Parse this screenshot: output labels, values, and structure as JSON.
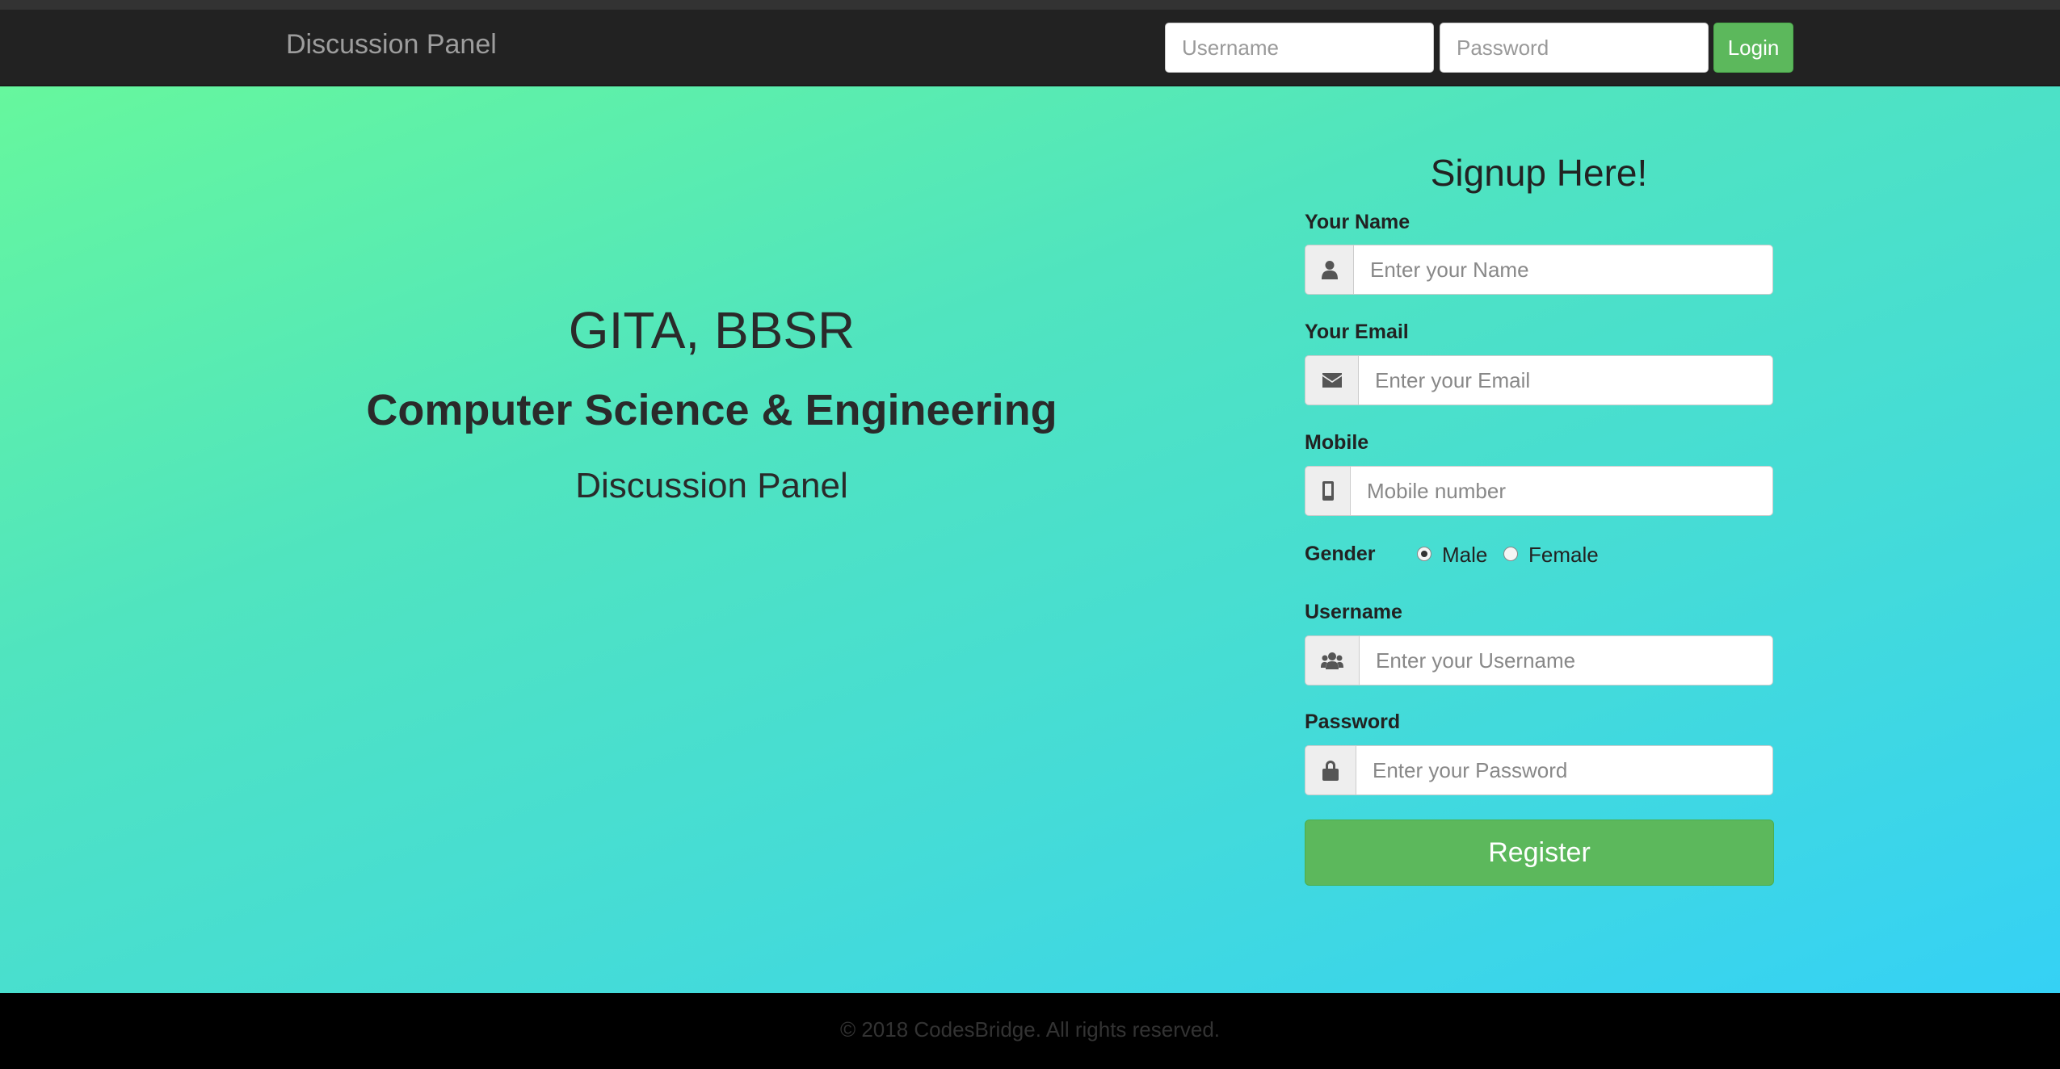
{
  "navbar": {
    "brand": "Discussion Panel",
    "username_placeholder": "Username",
    "password_placeholder": "Password",
    "login_label": "Login"
  },
  "hero": {
    "institute": "GITA, BBSR",
    "department": "Computer Science & Engineering",
    "subtitle": "Discussion Panel"
  },
  "signup": {
    "title": "Signup Here!",
    "name": {
      "label": "Your Name",
      "placeholder": "Enter your Name",
      "icon": "user-icon"
    },
    "email": {
      "label": "Your Email",
      "placeholder": "Enter your Email",
      "icon": "envelope-icon"
    },
    "mobile": {
      "label": "Mobile",
      "placeholder": "Mobile number",
      "icon": "mobile-icon"
    },
    "gender": {
      "label": "Gender",
      "options": [
        "Male",
        "Female"
      ],
      "selected": "Male"
    },
    "username": {
      "label": "Username",
      "placeholder": "Enter your Username",
      "icon": "users-icon"
    },
    "password": {
      "label": "Password",
      "placeholder": "Enter your Password",
      "icon": "lock-icon"
    },
    "register_label": "Register"
  },
  "footer": {
    "copyright": "© 2018 CodesBridge. All rights reserved."
  },
  "colors": {
    "navbar_bg": "#222222",
    "accent_green": "#5cb85c",
    "gradient_start": "#66f79d",
    "gradient_end": "#35d1f5",
    "footer_bg": "#000000"
  }
}
